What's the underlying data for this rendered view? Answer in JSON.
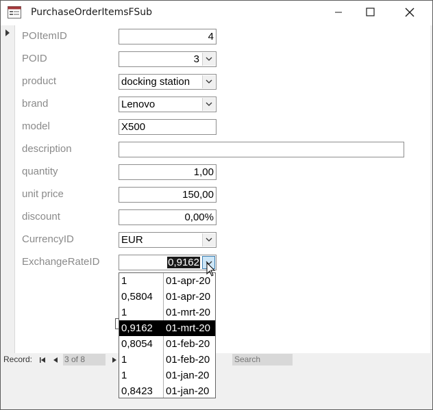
{
  "window": {
    "title": "PurchaseOrderItemsFSub"
  },
  "form": {
    "fields": [
      {
        "label": "POItemID",
        "value": "4"
      },
      {
        "label": "POID",
        "value": "3"
      },
      {
        "label": "product",
        "value": "docking station"
      },
      {
        "label": "brand",
        "value": "Lenovo"
      },
      {
        "label": "model",
        "value": "X500"
      },
      {
        "label": "description",
        "value": ""
      },
      {
        "label": "quantity",
        "value": "1,00"
      },
      {
        "label": "unit price",
        "value": "150,00"
      },
      {
        "label": "discount",
        "value": "0,00%"
      },
      {
        "label": "CurrencyID",
        "value": "EUR"
      },
      {
        "label": "ExchangeRateID",
        "value": "0,9162"
      }
    ]
  },
  "dropdown": {
    "rows": [
      {
        "rate": "1",
        "date": "01-apr-20"
      },
      {
        "rate": "0,5804",
        "date": "01-apr-20"
      },
      {
        "rate": "1",
        "date": "01-mrt-20"
      },
      {
        "rate": "0,9162",
        "date": "01-mrt-20"
      },
      {
        "rate": "0,8054",
        "date": "01-feb-20"
      },
      {
        "rate": "1",
        "date": "01-feb-20"
      },
      {
        "rate": "1",
        "date": "01-jan-20"
      },
      {
        "rate": "0,8423",
        "date": "01-jan-20"
      }
    ],
    "selected_index": 3
  },
  "navigation": {
    "record_label": "Record:",
    "current": "3 of 8",
    "search_placeholder": "Search"
  },
  "icons": {
    "app": "form-app-icon",
    "record_selector": "current-record-arrow-icon",
    "first": "first-record-icon",
    "prev": "previous-record-icon",
    "next": "next-record-icon",
    "dropdown": "chevron-down-icon",
    "cursor": "mouse-pointer-icon"
  }
}
